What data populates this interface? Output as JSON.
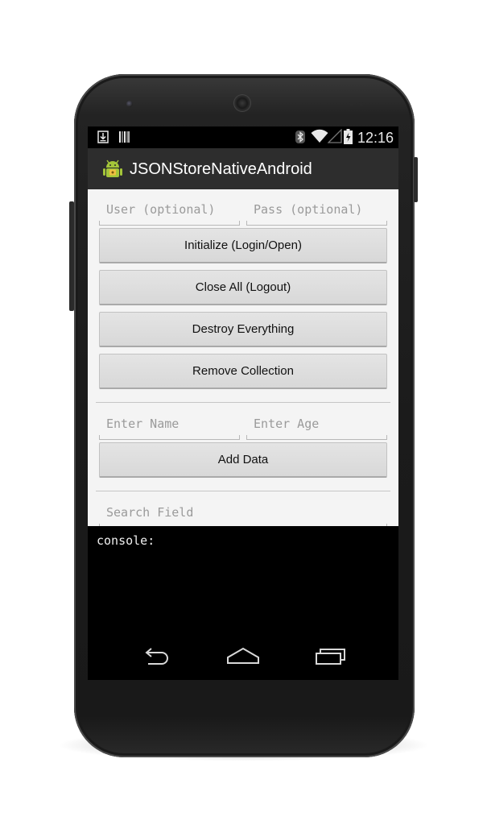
{
  "status_bar": {
    "left_icons": [
      "download-icon",
      "barcode-icon"
    ],
    "right_icons": [
      "bluetooth-icon",
      "wifi-icon",
      "signal-icon",
      "battery-icon"
    ],
    "time": "12:16"
  },
  "action_bar": {
    "title": "JSONStoreNativeAndroid",
    "icon": "android-app-icon"
  },
  "login": {
    "user_placeholder": "User (optional)",
    "pass_placeholder": "Pass (optional)"
  },
  "buttons": {
    "initialize": "Initialize (Login/Open)",
    "close_all": "Close All (Logout)",
    "destroy": "Destroy Everything",
    "remove_collection": "Remove Collection",
    "add_data": "Add Data"
  },
  "add_data_form": {
    "name_placeholder": "Enter Name",
    "age_placeholder": "Enter Age"
  },
  "search": {
    "field_placeholder": "Search Field"
  },
  "console": {
    "label": "console:"
  },
  "nav_bar": {
    "icons": [
      "back-icon",
      "home-icon",
      "recent-apps-icon"
    ]
  }
}
